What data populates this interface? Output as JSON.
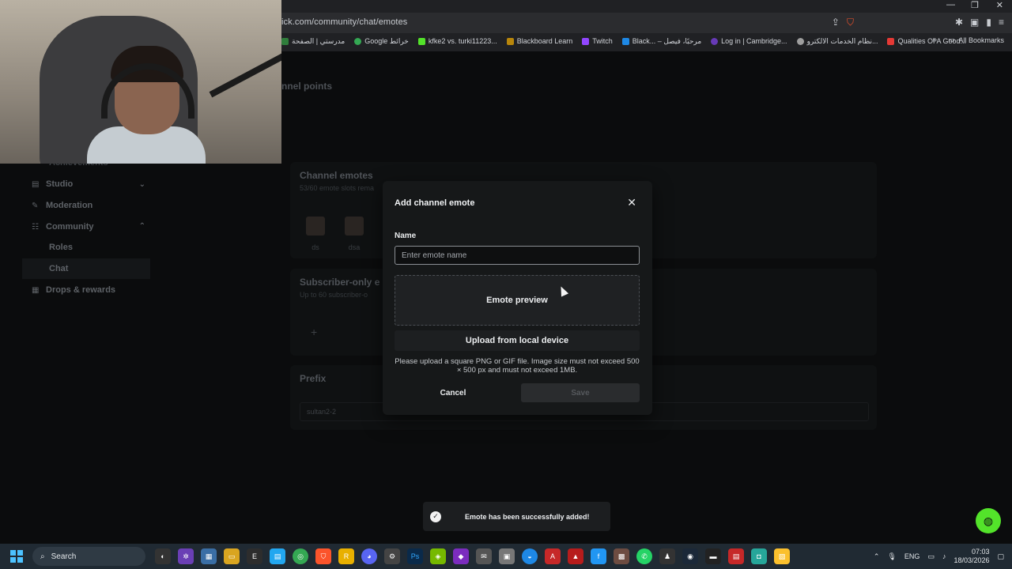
{
  "browser": {
    "url": "ick.com/community/chat/emotes",
    "bookmarks": [
      {
        "label": "مدرستي | الصفحة",
        "color": "#2f7d3b"
      },
      {
        "label": "Google خرائط",
        "color": "#34a853"
      },
      {
        "label": "kfke2 vs. turki11223...",
        "color": "#53e32a"
      },
      {
        "label": "Blackboard Learn",
        "color": "#b8860b"
      },
      {
        "label": "Twitch",
        "color": "#9146ff"
      },
      {
        "label": "Black... – مرحبًا، فيصل",
        "color": "#1e88e5"
      },
      {
        "label": "Log in | Cambridge...",
        "color": "#673ab7"
      },
      {
        "label": "نظام الخدمات الالكترو...",
        "color": "#9e9e9e"
      },
      {
        "label": "Qualities Of A Good...",
        "color": "#e53935"
      }
    ],
    "bookmarks_more": "»",
    "all_bookmarks": "All Bookmarks"
  },
  "page": {
    "channel_points": "nnel points",
    "partial_item": "Achievements",
    "sidebar": [
      {
        "label": "Studio",
        "icon": "studio-icon",
        "chevron": "⌄"
      },
      {
        "label": "Moderation",
        "icon": "wrench-icon",
        "chevron": ""
      },
      {
        "label": "Community",
        "icon": "community-icon",
        "chevron": "⌃"
      }
    ],
    "sidebar_sub": [
      {
        "label": "Roles"
      },
      {
        "label": "Chat"
      }
    ],
    "sidebar_last": {
      "label": "Drops & rewards",
      "icon": "gift-icon"
    },
    "channel_emotes": {
      "title": "Channel emotes",
      "subtitle": "53/60 emote slots rema",
      "emotes": [
        "ds",
        "dsa"
      ]
    },
    "subscriber_emotes": {
      "title": "Subscriber-only e",
      "subtitle": "Up to 60 subscriber-o",
      "add": "+"
    },
    "prefix": {
      "title": "Prefix",
      "value": "sultan2-2"
    }
  },
  "modal": {
    "title": "Add channel emote",
    "close": "✕",
    "name_label": "Name",
    "name_placeholder": "Enter emote name",
    "preview_label": "Emote preview",
    "upload_label": "Upload from local device",
    "hint": "Please upload a square PNG or GIF file. Image size must not exceed 500 × 500 px and must not exceed 1MB.",
    "cancel_label": "Cancel",
    "save_label": "Save"
  },
  "toast": {
    "message": "Emote has been successfully added!"
  },
  "taskbar": {
    "search_label": "Search",
    "language": "ENG",
    "time": "07:03",
    "date": "18/03/2026"
  }
}
